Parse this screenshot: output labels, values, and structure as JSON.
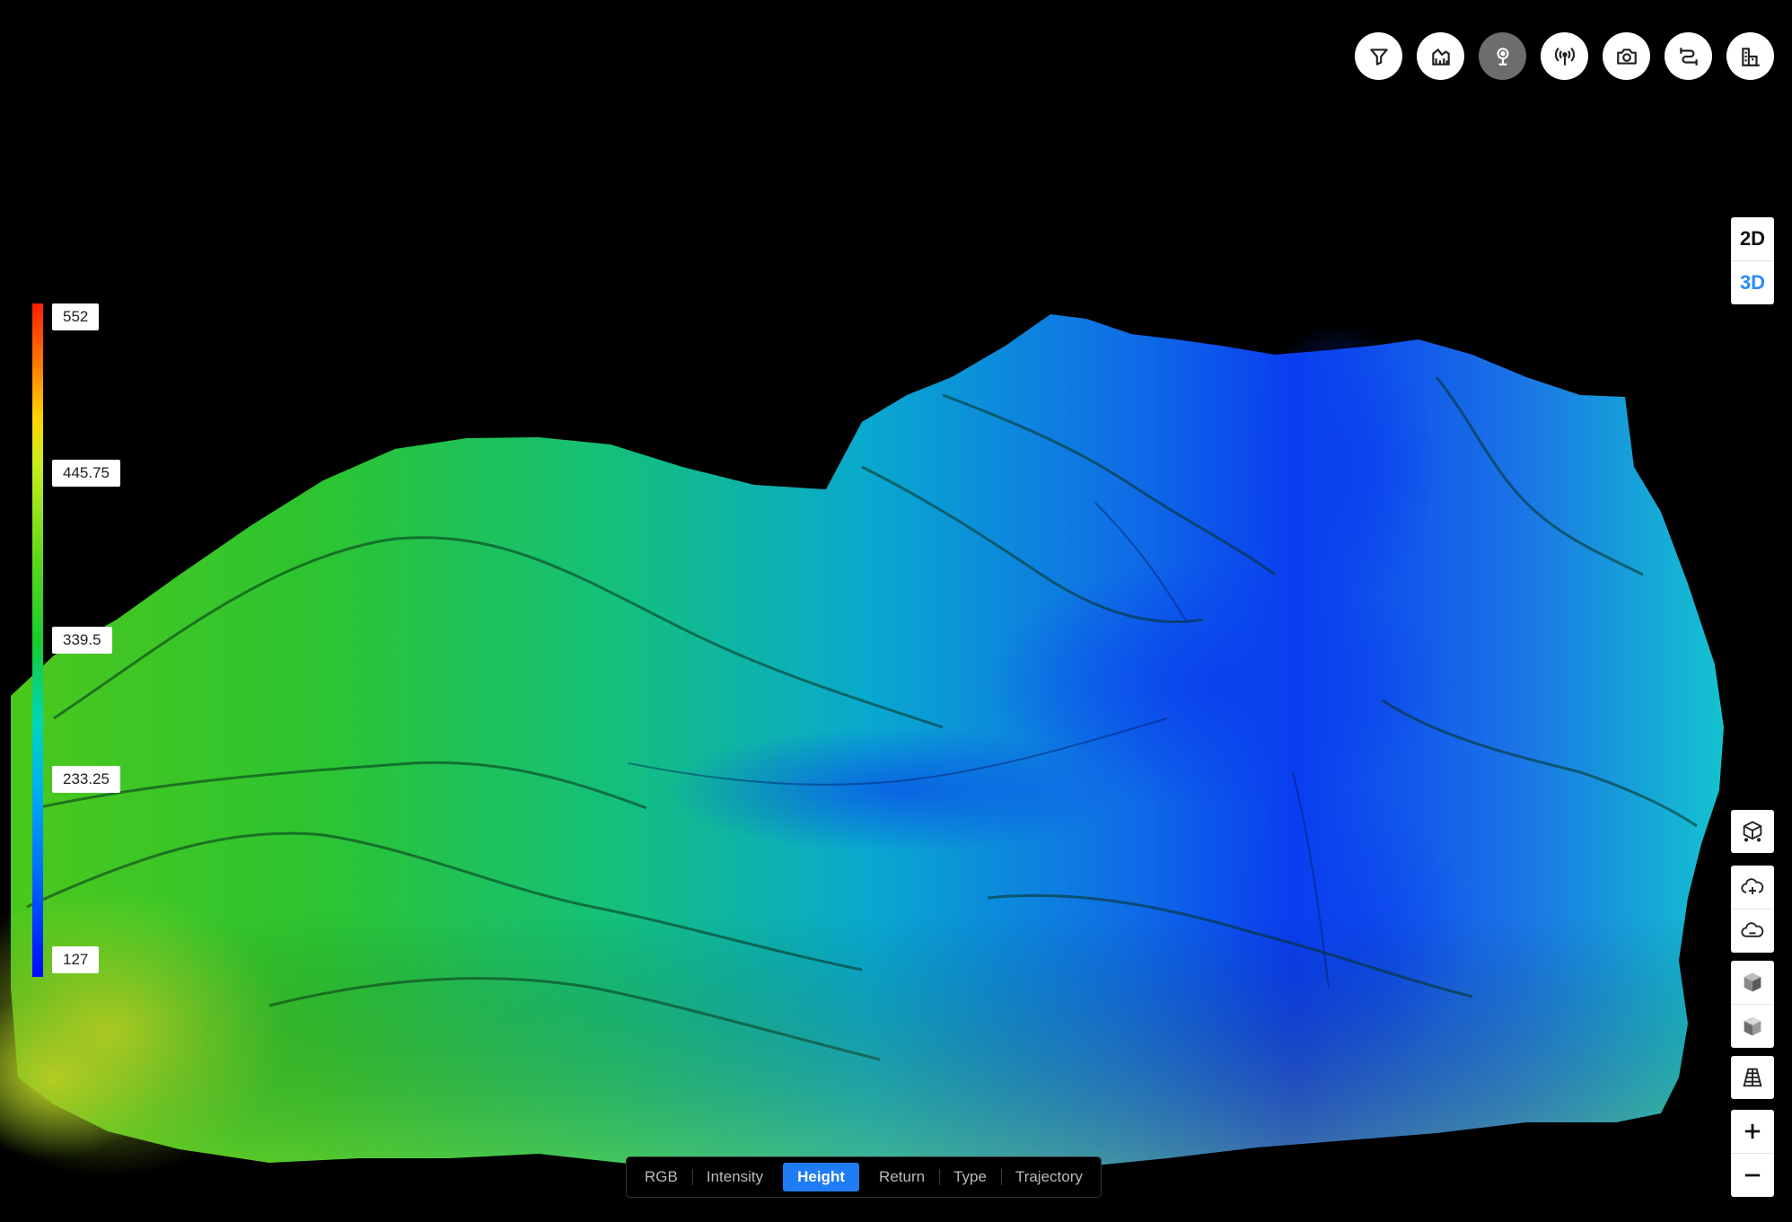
{
  "toolbar": {
    "buttons": [
      {
        "name": "filter-button",
        "icon": "filter-icon"
      },
      {
        "name": "area-chart-button",
        "icon": "area-chart-icon"
      },
      {
        "name": "location-pin-button",
        "icon": "location-pin-icon",
        "active": true
      },
      {
        "name": "antenna-button",
        "icon": "antenna-icon"
      },
      {
        "name": "camera-button",
        "icon": "camera-icon"
      },
      {
        "name": "route-button",
        "icon": "route-icon"
      },
      {
        "name": "building-button",
        "icon": "building-icon"
      }
    ]
  },
  "view_toggle": {
    "two_d": "2D",
    "three_d": "3D",
    "active": "3D"
  },
  "legend": {
    "labels": [
      "552",
      "445.75",
      "339.5",
      "233.25",
      "127"
    ],
    "max": 552,
    "min": 127
  },
  "render_modes": {
    "items": [
      "RGB",
      "Intensity",
      "Height",
      "Return",
      "Type",
      "Trajectory"
    ],
    "active": "Height"
  },
  "side_controls": {
    "icons": [
      "point-cloud-cube-icon",
      "cloud-add-icon",
      "cloud-remove-icon",
      "cube-solid-icon",
      "cube-shaded-icon",
      "perspective-grid-icon",
      "zoom-in-icon",
      "zoom-out-icon"
    ]
  },
  "colors": {
    "accent": "#1f7cf5",
    "active_toggle": "#2b8bff",
    "background": "#000000"
  }
}
